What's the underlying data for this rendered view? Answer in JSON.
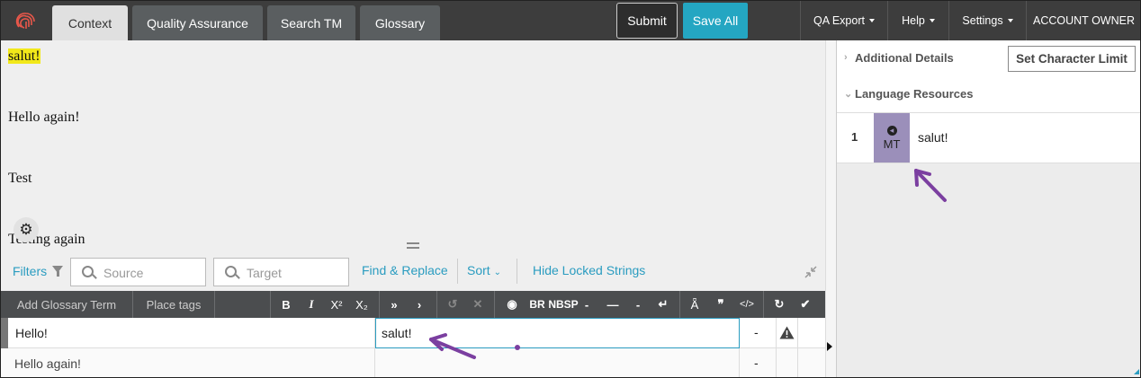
{
  "tabs": [
    {
      "label": "Context",
      "active": true
    },
    {
      "label": "Quality Assurance",
      "active": false
    },
    {
      "label": "Search TM",
      "active": false
    },
    {
      "label": "Glossary",
      "active": false
    }
  ],
  "actions": {
    "submit": "Submit",
    "save_all": "Save All"
  },
  "menus": [
    "QA Export",
    "Help",
    "Settings",
    "ACCOUNT OWNER"
  ],
  "context": {
    "lines": [
      "salut!",
      "Hello again!",
      "Test",
      "Testing again"
    ]
  },
  "filters": {
    "label": "Filters",
    "source_placeholder": "Source",
    "target_placeholder": "Target",
    "find_replace": "Find & Replace",
    "sort": "Sort",
    "hide_locked": "Hide Locked Strings"
  },
  "toolbar": {
    "add_glossary": "Add Glossary Term",
    "place_tags": "Place tags",
    "bold": "B",
    "italic": "I",
    "superscript": "X²",
    "subscript": "X₂",
    "br": "BR",
    "nbsp": "NBSP"
  },
  "rows": [
    {
      "source": "Hello!",
      "target": "salut!",
      "status": "-"
    },
    {
      "source": "Hello again!",
      "target": "",
      "status": "-"
    }
  ],
  "right_panel": {
    "additional_details": "Additional Details",
    "set_char_limit": "Set Character Limit",
    "language_resources": "Language Resources",
    "resources": [
      {
        "index": "1",
        "type": "MT",
        "text": "salut!"
      }
    ]
  },
  "colors": {
    "accent": "#24a6c2",
    "topbar": "#3d3d3d",
    "mt_badge": "#9b8fba",
    "annotation_arrow": "#7b3fa0",
    "highlight": "#f2e81a"
  }
}
